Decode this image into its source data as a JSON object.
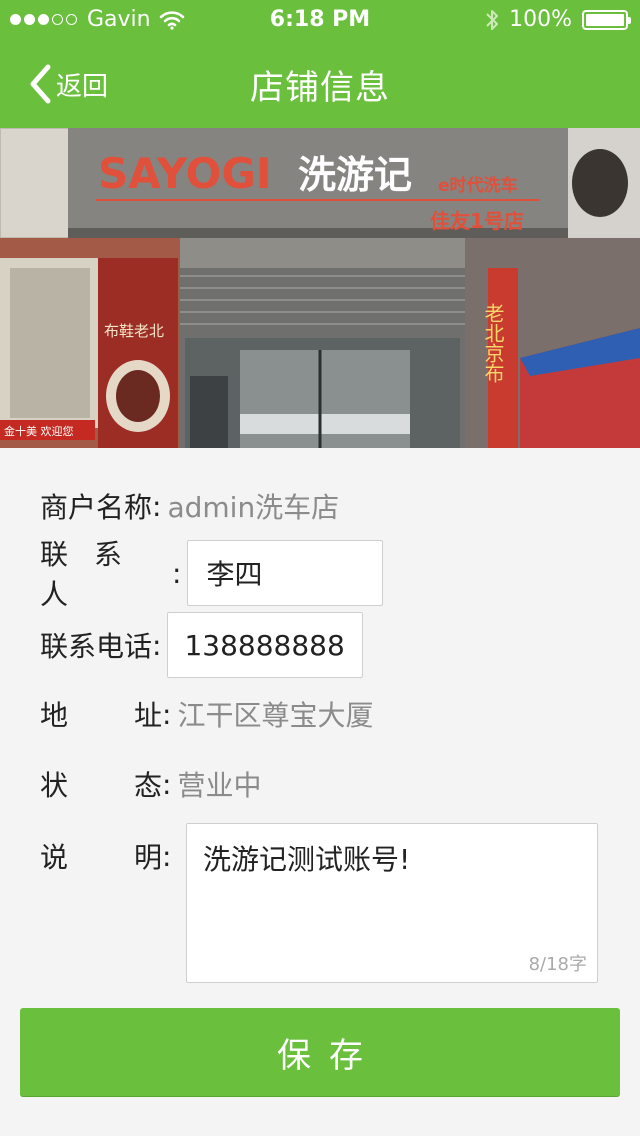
{
  "status_bar": {
    "carrier": "Gavin",
    "time": "6:18 PM",
    "battery": "100%",
    "signal_bars_filled": 3,
    "signal_bars_total": 5
  },
  "nav": {
    "back_label": "返回",
    "title": "店铺信息"
  },
  "banner": {
    "sign_brand": "SAYOGI",
    "sign_name": "洗游记",
    "sign_sub": "e时代洗车",
    "sign_branch": "佳友1号店",
    "side_sign_right": "老北京布",
    "side_sign_left": "布鞋老北",
    "shop_strip": "金十美 欢迎您"
  },
  "form": {
    "merchant": {
      "label": "商户名称",
      "value": "admin洗车店"
    },
    "contact": {
      "label": "联系人",
      "value": "李四"
    },
    "phone": {
      "label": "联系电话",
      "value": "138888888"
    },
    "address": {
      "label": "地址",
      "value": "江干区尊宝大厦"
    },
    "status": {
      "label": "状态",
      "value": "营业中"
    },
    "description": {
      "label": "说明",
      "value": "洗游记测试账号!",
      "counter": "8/18字"
    }
  },
  "save_button": {
    "label": "保存"
  },
  "colors": {
    "brand_green": "#6abf3c",
    "muted_text": "#8b8b8b"
  }
}
